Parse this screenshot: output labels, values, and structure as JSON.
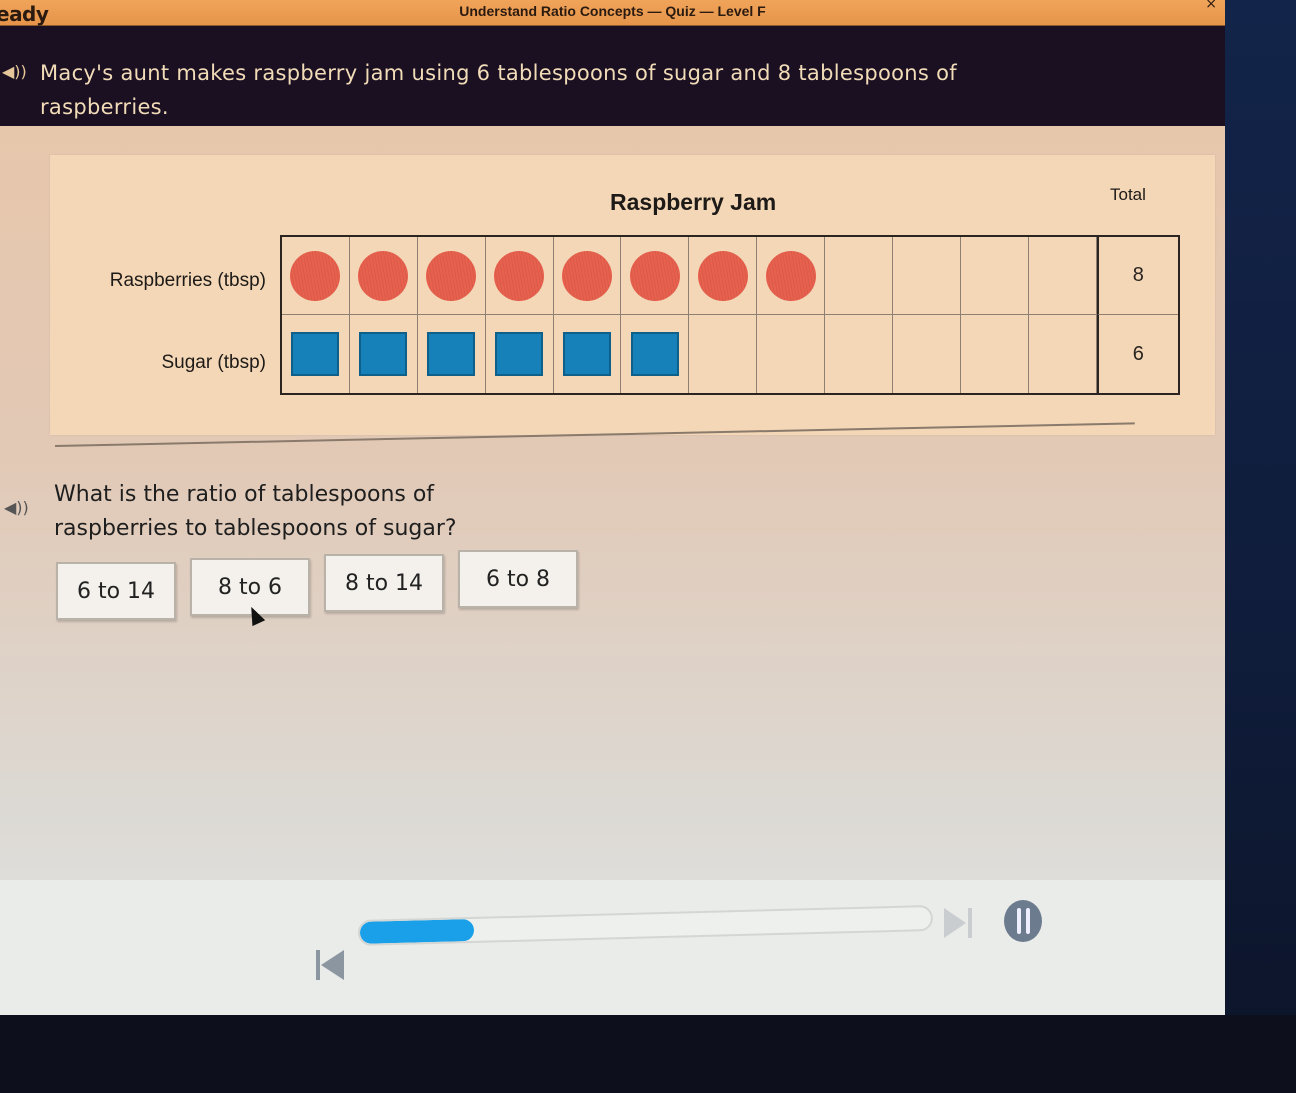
{
  "window": {
    "brand_partial": "eady",
    "title": "Understand Ratio Concepts — Quiz — Level F",
    "close_label": "×"
  },
  "prompt": {
    "audio_icon": "speaker-icon",
    "text": "Macy's aunt makes raspberry jam using 6 tablespoons of sugar and 8 tablespoons of raspberries."
  },
  "chart_data": {
    "type": "table",
    "title": "Raspberry Jam",
    "total_header": "Total",
    "columns": 12,
    "rows": [
      {
        "label": "Raspberries (tbsp)",
        "count": 8,
        "total": "8",
        "symbol": "circle",
        "color": "#e8604e"
      },
      {
        "label": "Sugar (tbsp)",
        "count": 6,
        "total": "6",
        "symbol": "square",
        "color": "#1680b8"
      }
    ]
  },
  "question": {
    "audio_icon": "speaker-icon",
    "text": "What is the ratio of tablespoons of raspberries to tablespoons of sugar?",
    "answers": [
      "6 to 14",
      "8 to 6",
      "8 to 14",
      "6 to 8"
    ]
  },
  "controls": {
    "progress_percent": 20,
    "progress_color": "#1aa0e8",
    "back_icon": "skip-back-icon",
    "forward_icon": "skip-forward-icon",
    "pause_icon": "pause-icon",
    "settings_icon": "gear-icon",
    "settings_glyph": "⚙"
  }
}
